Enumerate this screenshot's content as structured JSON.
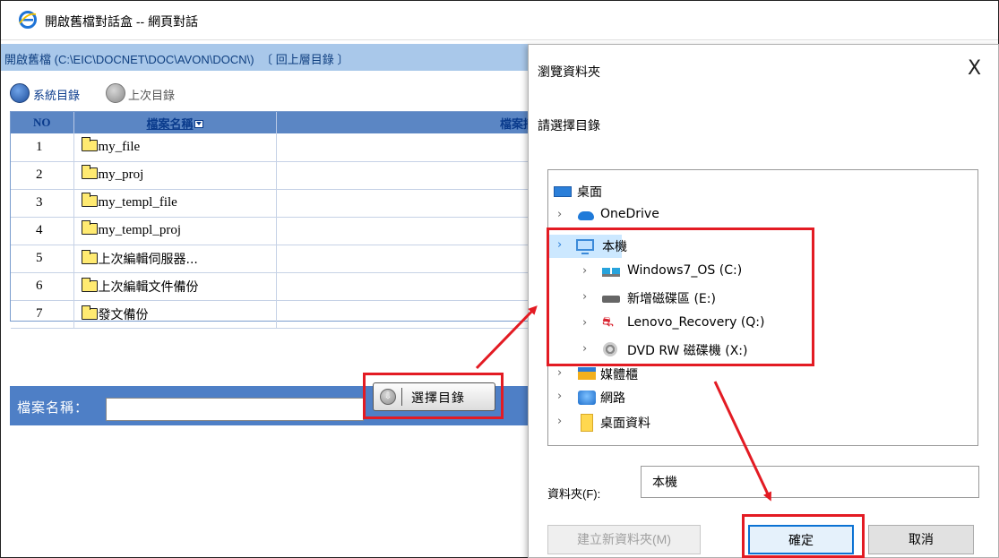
{
  "window": {
    "title": "開啟舊檔對話盒 -- 網頁對話"
  },
  "pathbar": {
    "text": "開啟舊檔 (C:\\EIC\\DOCNET\\DOC\\AVON\\DOCN\\)",
    "up_link": "〔 回上層目錄 〕"
  },
  "toolbar": {
    "system_dir": "系統目錄",
    "last_dir": "上次目錄"
  },
  "table": {
    "headers": {
      "no": "NO",
      "name": "檔案名稱",
      "abstract": "檔案摘"
    },
    "rows": [
      {
        "no": "1",
        "name": "my_file"
      },
      {
        "no": "2",
        "name": "my_proj"
      },
      {
        "no": "3",
        "name": "my_templ_file"
      },
      {
        "no": "4",
        "name": "my_templ_proj"
      },
      {
        "no": "5",
        "name": "上次編輯伺服器..."
      },
      {
        "no": "6",
        "name": "上次編輯文件備份"
      },
      {
        "no": "7",
        "name": "發文備份"
      }
    ]
  },
  "filename_bar": {
    "label": "檔案名稱：",
    "value": "",
    "choose_dir_button": "選擇目錄"
  },
  "dialog": {
    "title": "瀏覽資料夾",
    "close": "X",
    "prompt": "請選擇目錄",
    "tree": {
      "desktop": "桌面",
      "onedrive": "OneDrive",
      "this_pc": "本機",
      "drive_c": "Windows7_OS (C:)",
      "drive_e": "新增磁碟區 (E:)",
      "drive_q": "Lenovo_Recovery (Q:)",
      "drive_x": "DVD RW 磁碟機 (X:)",
      "media": "媒體櫃",
      "network": "網路",
      "desktop_data": "桌面資料"
    },
    "folder_label": "資料夾(F):",
    "folder_value": "本機",
    "new_folder_button": "建立新資料夾(M)",
    "ok_button": "確定",
    "cancel_button": "取消"
  },
  "colors": {
    "highlight": "#e31b23",
    "pathbar": "#a9c8ea",
    "filename_bar": "#4e7fc6",
    "selection": "#cce8ff"
  }
}
